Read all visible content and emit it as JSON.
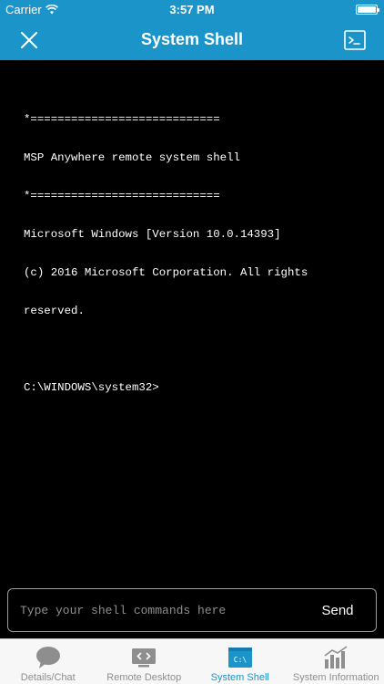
{
  "status_bar": {
    "carrier": "Carrier",
    "time": "3:57 PM",
    "battery_level": 1.0
  },
  "nav": {
    "title": "System Shell",
    "close_icon": "close-icon",
    "shell_icon": "terminal-icon"
  },
  "terminal": {
    "lines": [
      "*============================",
      "MSP Anywhere remote system shell",
      "*============================",
      "Microsoft Windows [Version 10.0.14393]",
      "(c) 2016 Microsoft Corporation. All rights",
      "reserved.",
      "",
      "C:\\WINDOWS\\system32>"
    ]
  },
  "input": {
    "value": "",
    "placeholder": "Type your shell commands here",
    "send_label": "Send"
  },
  "tabs": [
    {
      "label": "Details/Chat",
      "icon": "chat-bubble-icon",
      "active": false
    },
    {
      "label": "Remote Desktop",
      "icon": "remote-desktop-icon",
      "active": false
    },
    {
      "label": "System Shell",
      "icon": "shell-window-icon",
      "active": true
    },
    {
      "label": "System Information",
      "icon": "bar-chart-icon",
      "active": false
    }
  ],
  "colors": {
    "accent": "#1b95c9",
    "terminal_bg": "#000000",
    "tab_inactive": "#8e8e8e"
  }
}
